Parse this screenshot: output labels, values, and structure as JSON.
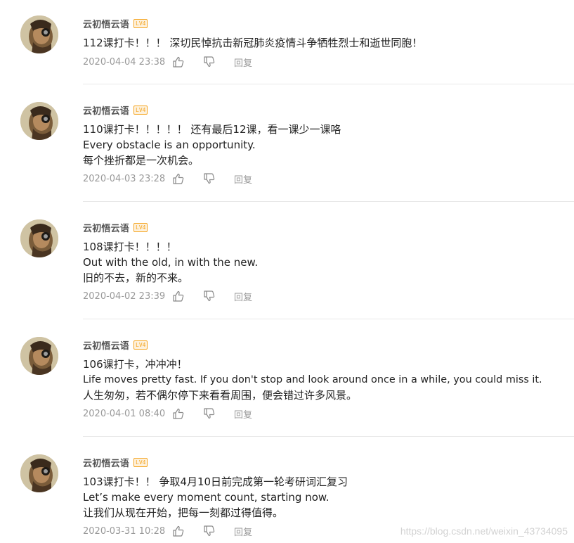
{
  "comments": [
    {
      "username": "云初悟云语",
      "level": "LV4",
      "lines": [
        "112课打卡！！！ 深切民悼抗击新冠肺炎疫情斗争牺牲烈士和逝世同胞！"
      ],
      "timestamp": "2020-04-04 23:38",
      "reply_label": "回复"
    },
    {
      "username": "云初悟云语",
      "level": "LV4",
      "lines": [
        "110课打卡！！！！！ 还有最后12课，看一课少一课咯",
        "Every obstacle is an opportunity.",
        "每个挫折都是一次机会。"
      ],
      "timestamp": "2020-04-03 23:28",
      "reply_label": "回复"
    },
    {
      "username": "云初悟云语",
      "level": "LV4",
      "lines": [
        "108课打卡！！！！",
        "Out with the old, in with the new.",
        "旧的不去，新的不来。"
      ],
      "timestamp": "2020-04-02 23:39",
      "reply_label": "回复"
    },
    {
      "username": "云初悟云语",
      "level": "LV4",
      "lines": [
        "106课打卡，冲冲冲！",
        "Life moves pretty fast. If you don't stop and look around once in a while, you could miss it.",
        "人生匆匆，若不偶尔停下来看看周围，便会错过许多风景。"
      ],
      "timestamp": "2020-04-01 08:40",
      "reply_label": "回复"
    },
    {
      "username": "云初悟云语",
      "level": "LV4",
      "lines": [
        "103课打卡！！ 争取4月10日前完成第一轮考研词汇复习",
        "Let’s make every moment count, starting now.",
        "让我们从现在开始，把每一刻都过得值得。"
      ],
      "timestamp": "2020-03-31 10:28",
      "reply_label": "回复"
    }
  ],
  "watermark": "https://blog.csdn.net/weixin_43734095",
  "icons": {
    "like": "thumbs-up-icon",
    "dislike": "thumbs-down-icon"
  },
  "colors": {
    "badge": "#f5a623",
    "meta_text": "#999999",
    "body_text": "#222222"
  }
}
